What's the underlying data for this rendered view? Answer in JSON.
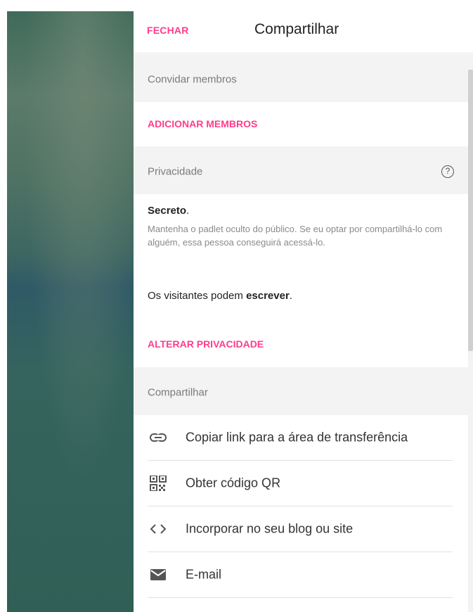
{
  "header": {
    "close_label": "FECHAR",
    "title": "Compartilhar"
  },
  "invite": {
    "section_label": "Convidar membros",
    "add_members_label": "ADICIONAR MEMBROS"
  },
  "privacy": {
    "section_label": "Privacidade",
    "help_icon": "question-circle-icon",
    "level": "Secreto",
    "level_suffix": ".",
    "description": "Mantenha o padlet oculto do público. Se eu optar por compartilhá-lo com alguém, essa pessoa conseguirá acessá-lo.",
    "visitors_prefix": "Os visitantes podem ",
    "visitors_permission": "escrever",
    "visitors_suffix": ".",
    "change_label": "ALTERAR PRIVACIDADE"
  },
  "share": {
    "section_label": "Compartilhar",
    "options": [
      {
        "icon": "link-icon",
        "label": "Copiar link para a área de transferência"
      },
      {
        "icon": "qr-code-icon",
        "label": "Obter código QR"
      },
      {
        "icon": "code-brackets-icon",
        "label": "Incorporar no seu blog ou site"
      },
      {
        "icon": "email-envelope-icon",
        "label": "E-mail"
      }
    ]
  },
  "colors": {
    "accent": "#ff3d8b",
    "section_background": "#f3f3f3",
    "text_primary": "#222222",
    "text_secondary": "#8a8a8a"
  }
}
